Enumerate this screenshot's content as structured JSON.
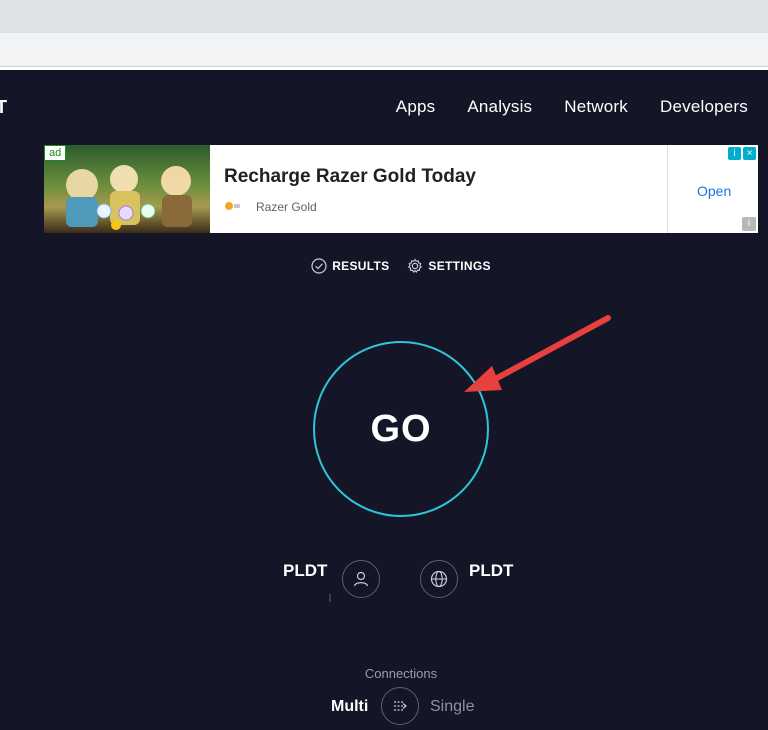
{
  "header": {
    "logo_fragment": "T",
    "nav": [
      "Apps",
      "Analysis",
      "Network",
      "Developers"
    ]
  },
  "ad": {
    "badge": "ad",
    "title": "Recharge Razer Gold Today",
    "brand": "Razer Gold",
    "cta": "Open",
    "choices_icons": [
      "info-icon",
      "close-icon"
    ]
  },
  "toggles": {
    "results": "RESULTS",
    "settings": "SETTINGS"
  },
  "go": {
    "label": "GO",
    "ring_color": "#2ec6d6"
  },
  "isp": {
    "provider": "PLDT",
    "server": "PLDT"
  },
  "connections": {
    "title": "Connections",
    "multi": "Multi",
    "single": "Single"
  },
  "colors": {
    "background": "#141526",
    "accent": "#2ec6d6",
    "annotation_arrow": "#e8403f"
  }
}
